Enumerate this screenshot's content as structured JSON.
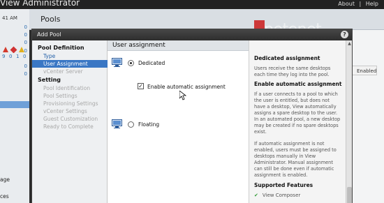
{
  "app": {
    "title": "View Administrator",
    "links": [
      "About",
      "|",
      "Help"
    ]
  },
  "background": {
    "pools_title": "Pools",
    "time_fragment": "41 AM",
    "left_numbers": [
      "0",
      "0",
      "0",
      "0",
      "0",
      "0"
    ],
    "status_counts": [
      "9",
      "0",
      "1",
      "0"
    ],
    "left_fragments": [
      "age",
      "ces"
    ],
    "enabled_column": "Enabled"
  },
  "watermark": "petenet",
  "dialog": {
    "title": "Add Pool",
    "help_button": "?"
  },
  "nav": {
    "pool_definition_header": "Pool Definition",
    "type": "Type",
    "user_assignment": "User Assignment",
    "vcenter_server": "vCenter Server",
    "setting_header": "Setting",
    "pool_identification": "Pool Identification",
    "pool_settings": "Pool Settings",
    "provisioning_settings": "Provisioning Settings",
    "vcenter_settings": "vCenter Settings",
    "guest_customization": "Guest Customization",
    "ready_to_complete": "Ready to Complete"
  },
  "content": {
    "title": "User assignment",
    "dedicated_label": "Dedicated",
    "auto_assign_label": "Enable automatic assignment",
    "floating_label": "Floating",
    "dedicated_selected": true,
    "auto_assign_checked": true
  },
  "help": {
    "dedicated_heading": "Dedicated assignment",
    "dedicated_text_1": "Users receive the same desktops",
    "dedicated_text_2": "each time they log into the pool.",
    "auto_heading": "Enable automatic assignment",
    "auto_text": [
      "If a user connects to a pool to which",
      "the user is entitled, but does not",
      "have a desktop, View automatically",
      "assigns a spare desktop to the user.",
      "In an automated pool, a new desktop",
      "may be created if no spare desktops",
      "exist."
    ],
    "manual_text": [
      "If automatic assignment is not",
      "enabled, users must be assigned to",
      "desktops manually in View",
      "Administrator. Manual assignment",
      "can still be done even if automatic",
      "assignment is enabled."
    ],
    "features_heading": "Supported Features",
    "feature_1": "View Composer"
  },
  "colors": {
    "nav_active": "#3a77c4",
    "nav_done_link": "#2360a8",
    "check_green": "#2f9a35"
  }
}
